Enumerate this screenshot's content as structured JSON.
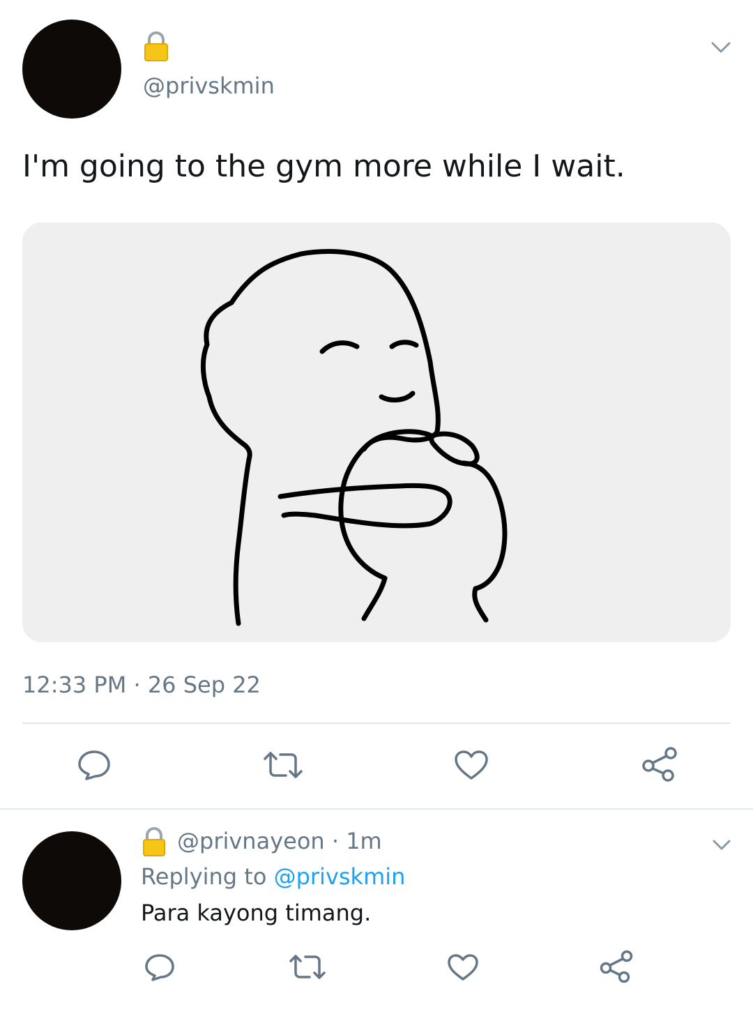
{
  "tweet": {
    "lock_icon": "lock-icon",
    "handle": "@privskmin",
    "text": "I'm going to the gym more while I wait.",
    "time": "12:33 PM",
    "separator": " · ",
    "date": "26 Sep 22",
    "actions": [
      "reply-icon",
      "retweet-icon",
      "like-icon",
      "share-icon"
    ]
  },
  "reply": {
    "lock_icon": "lock-icon",
    "handle": "@privnayeon",
    "separator": " · ",
    "age": "1m",
    "replying_prefix": "Replying to ",
    "replying_handle": "@privskmin",
    "text": "Para kayong timang.",
    "actions": [
      "reply-icon",
      "retweet-icon",
      "like-icon",
      "share-icon"
    ]
  },
  "colors": {
    "text_primary": "#14171a",
    "text_secondary": "#657786",
    "link": "#1da1f2",
    "divider": "#e1e8ed",
    "media_bg": "#efefef",
    "lock_body": "#f5c518"
  }
}
